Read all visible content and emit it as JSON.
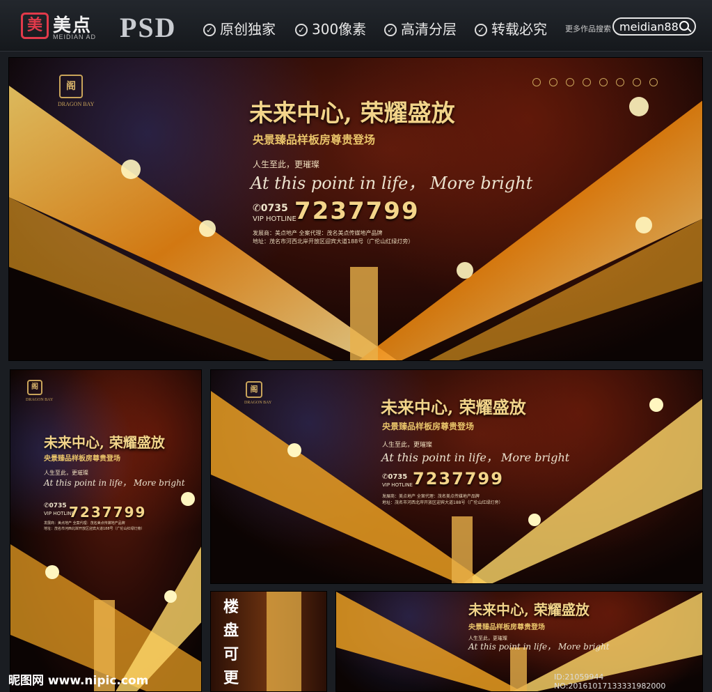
{
  "header": {
    "logo_mark": "美",
    "logo_text": "美点",
    "logo_sub": "MEIDIAN AD",
    "format": "PSD",
    "features": [
      "原创独家",
      "300像素",
      "高清分层",
      "转载必究"
    ],
    "search_label": "更多作品搜索",
    "search_value": "meidian88"
  },
  "banner": {
    "title": "未来中心, 荣耀盛放",
    "subtitle": "央景臻品样板房尊贵登场",
    "tagline_cn": "人生至此，更璀璨",
    "tagline_en": "At this point in life，  More bright",
    "phone_prefix": "✆0735",
    "vip": "VIP HOTLINE",
    "phone": "7237799",
    "developer": "发展商：美点地产    全案代理：茂名美点传媒地产品牌",
    "address": "地址：茂名市河西北岸开放区迎宾大道188号（广伦山红绿灯旁）",
    "brand": "DRAGON BAY"
  },
  "side_text": "楼盘可更换",
  "watermark": "昵图网 www.nipic.com",
  "id_line": "ID:21059944 NO:20161017133331982000",
  "colors": {
    "gold": "#f2d48a",
    "accent": "#e23a4a"
  }
}
